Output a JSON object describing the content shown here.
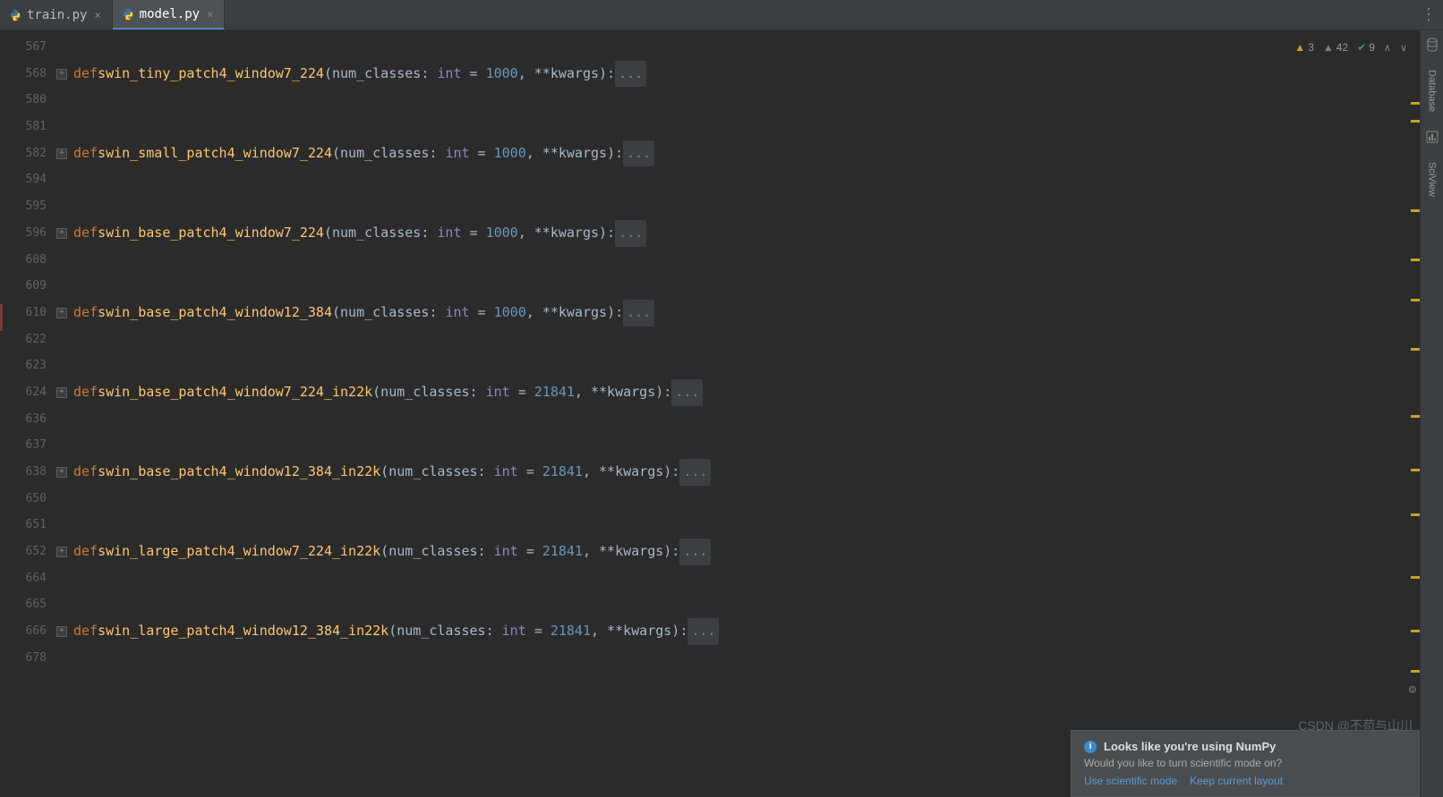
{
  "tabs": [
    {
      "label": "train.py",
      "active": false
    },
    {
      "label": "model.py",
      "active": true
    }
  ],
  "inspections": {
    "warn_yellow": "3",
    "warn_gray": "42",
    "typo_green": "9"
  },
  "right_tools": {
    "database": "Database",
    "sciview": "SciView"
  },
  "code": {
    "line_numbers": [
      "567",
      "568",
      "580",
      "581",
      "582",
      "594",
      "595",
      "596",
      "608",
      "609",
      "610",
      "622",
      "623",
      "624",
      "636",
      "637",
      "638",
      "650",
      "651",
      "652",
      "664",
      "665",
      "666",
      "678"
    ],
    "fold_rows": [
      1,
      4,
      7,
      10,
      13,
      16,
      19,
      22
    ],
    "defs": [
      {
        "row": 1,
        "name": "swin_tiny_patch4_window7_224",
        "default": "1000"
      },
      {
        "row": 4,
        "name": "swin_small_patch4_window7_224",
        "default": "1000"
      },
      {
        "row": 7,
        "name": "swin_base_patch4_window7_224",
        "default": "1000"
      },
      {
        "row": 10,
        "name": "swin_base_patch4_window12_384",
        "default": "1000"
      },
      {
        "row": 13,
        "name": "swin_base_patch4_window7_224_in22k",
        "default": "21841"
      },
      {
        "row": 16,
        "name": "swin_base_patch4_window12_384_in22k",
        "default": "21841"
      },
      {
        "row": 19,
        "name": "swin_large_patch4_window7_224_in22k",
        "default": "21841"
      },
      {
        "row": 22,
        "name": "swin_large_patch4_window12_384_in22k",
        "default": "21841"
      }
    ],
    "tokens": {
      "def": "def",
      "param": "num_classes",
      "type": "int",
      "eq": " = ",
      "comma": ", ",
      "kwargs": "**kwargs",
      "folded": "..."
    }
  },
  "notification": {
    "title": "Looks like you're using NumPy",
    "body": "Would you like to turn scientific mode on?",
    "action1": "Use scientific mode",
    "action2": "Keep current layout"
  },
  "watermark": "CSDN @不苟与山川"
}
